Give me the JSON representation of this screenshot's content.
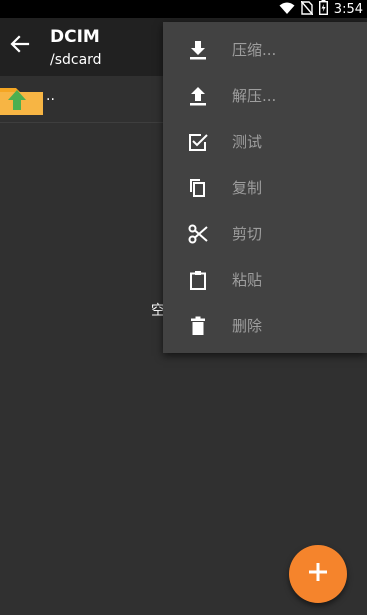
{
  "status_bar": {
    "time": "3:54",
    "icons": [
      "wifi-icon",
      "no-sim-icon",
      "battery-icon"
    ]
  },
  "toolbar": {
    "title": "DCIM",
    "subtitle": "/sdcard",
    "back_icon": "arrow-back-icon"
  },
  "file_list": {
    "items": [
      {
        "label": "..",
        "icon": "folder-up-icon"
      }
    ],
    "empty_text": "空"
  },
  "context_menu": {
    "items": [
      {
        "label": "压缩...",
        "icon": "download-icon"
      },
      {
        "label": "解压...",
        "icon": "upload-icon"
      },
      {
        "label": "测试",
        "icon": "checkbox-icon"
      },
      {
        "label": "复制",
        "icon": "copy-icon"
      },
      {
        "label": "剪切",
        "icon": "scissors-icon"
      },
      {
        "label": "粘贴",
        "icon": "clipboard-icon"
      },
      {
        "label": "删除",
        "icon": "trash-icon"
      }
    ]
  },
  "fab": {
    "icon": "plus-icon"
  },
  "colors": {
    "background": "#303030",
    "toolbar": "#212121",
    "menu": "#424242",
    "menu_text": "#9e9e9e",
    "fab": "#f5842c",
    "folder": "#f5a623",
    "folder_arrow": "#4caf50"
  }
}
